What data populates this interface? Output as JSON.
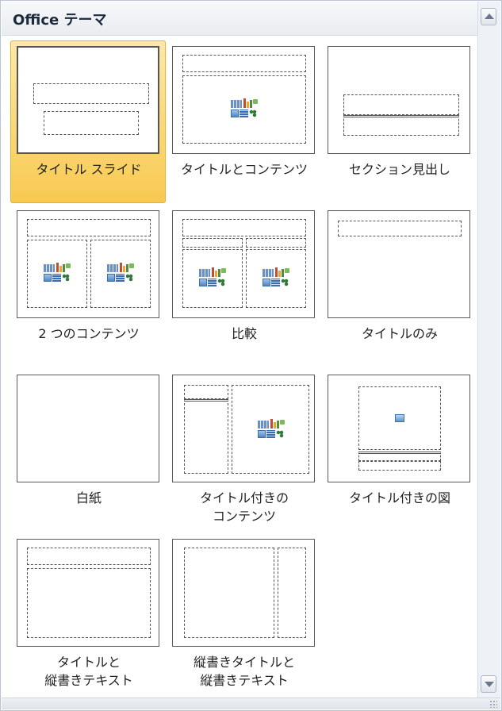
{
  "header": {
    "title": "Office テーマ"
  },
  "layouts": [
    {
      "id": "title-slide",
      "label": "タイトル スライド",
      "selected": true
    },
    {
      "id": "title-and-content",
      "label": "タイトルとコンテンツ",
      "selected": false
    },
    {
      "id": "section-header",
      "label": "セクション見出し",
      "selected": false
    },
    {
      "id": "two-content",
      "label": "2 つのコンテンツ",
      "selected": false
    },
    {
      "id": "comparison",
      "label": "比較",
      "selected": false
    },
    {
      "id": "title-only",
      "label": "タイトルのみ",
      "selected": false
    },
    {
      "id": "blank",
      "label": "白紙",
      "selected": false
    },
    {
      "id": "content-with-caption",
      "label": "タイトル付きの\nコンテンツ",
      "selected": false
    },
    {
      "id": "picture-with-caption",
      "label": "タイトル付きの図",
      "selected": false
    },
    {
      "id": "title-and-vertical-text",
      "label": "タイトルと\n縦書きテキスト",
      "selected": false
    },
    {
      "id": "vertical-title-and-text",
      "label": "縦書きタイトルと\n縦書きテキスト",
      "selected": false
    }
  ],
  "colors": {
    "selected_fill": "#f8c951",
    "selected_border": "#e3b234",
    "panel_border": "#b9c5d6"
  },
  "icons": {
    "scroll_up": "triangle-up-icon",
    "scroll_down": "triangle-down-icon",
    "resize": "resize-grip-icon"
  }
}
